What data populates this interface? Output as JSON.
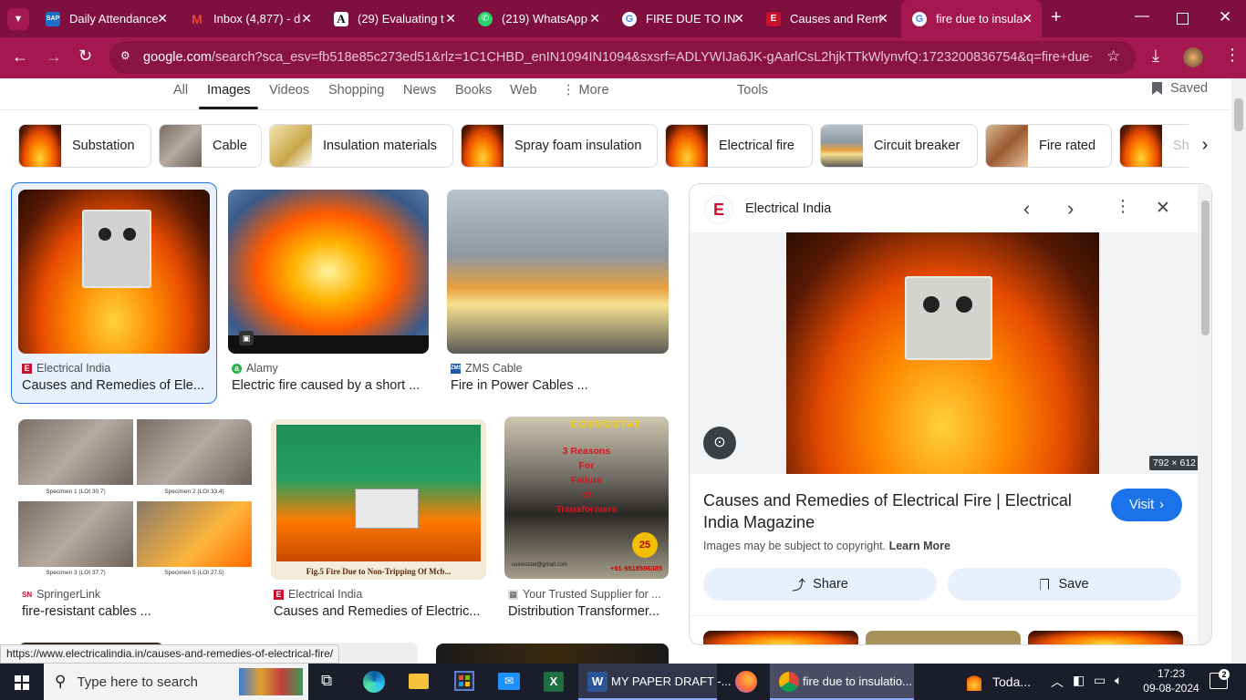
{
  "tabs": [
    {
      "label": "Daily Attendance",
      "icon": "sap-icon"
    },
    {
      "label": "Inbox (4,877) - d",
      "icon": "gmail-icon"
    },
    {
      "label": "(29) Evaluating t",
      "icon": "academia-icon"
    },
    {
      "label": "(219) WhatsApp",
      "icon": "whatsapp-icon"
    },
    {
      "label": "FIRE DUE TO INS",
      "icon": "google-icon"
    },
    {
      "label": "Causes and Rem",
      "icon": "electrical-india-icon"
    },
    {
      "label": "fire due to insula",
      "icon": "google-icon"
    }
  ],
  "address": {
    "host": "google.com",
    "path": "/search?sca_esv=fb518e85c273ed51&rlz=1C1CHBD_enIN1094IN1094&sxsrf=ADLYWIJa6JK-gAarlCsL2hjkTTkWlynvfQ:1723200836754&q=fire+due+to+ins..."
  },
  "nav": {
    "all": "All",
    "images": "Images",
    "videos": "Videos",
    "shopping": "Shopping",
    "news": "News",
    "books": "Books",
    "web": "Web",
    "more": "More",
    "tools": "Tools",
    "saved": "Saved"
  },
  "chips": [
    "Substation",
    "Cable",
    "Insulation materials",
    "Spray foam insulation",
    "Electrical fire",
    "Circuit breaker",
    "Fire rated",
    "Sh"
  ],
  "results": [
    {
      "source": "Electrical India",
      "title": "Causes and Remedies of Ele..."
    },
    {
      "source": "Alamy",
      "title": "Electric fire caused by a short ..."
    },
    {
      "source": "ZMS Cable",
      "title": "Fire in Power Cables ..."
    },
    {
      "source": "SpringerLink",
      "title": "fire-resistant cables ..."
    },
    {
      "source": "Electrical India",
      "title": "Causes and Remedies of Electric..."
    },
    {
      "source": "Your Trusted Supplier for ...",
      "title": "Distribution Transformer..."
    }
  ],
  "specimens": [
    "Specimen 1 (LOI 30.7)",
    "Specimen 2 (LOI 33.4)",
    "Specimen 3 (LOI 37.7)",
    "Specimen 5 (LOI 27.5)"
  ],
  "fig_caption": "Fig.5 Fire Due to Non-Tripping Of Mcb...",
  "poster": {
    "brand": "COSMOSTAT",
    "lines": [
      "3 Reasons",
      "For",
      "Failure",
      "of",
      "Transformers"
    ],
    "years": "25",
    "phone": "+91-9818596385",
    "email": "cosmostat@gmail.com"
  },
  "panel": {
    "source": "Electrical India",
    "dimensions": "792 × 612",
    "title": "Causes and Remedies of Electrical Fire | Electrical India Magazine",
    "copyright": "Images may be subject to copyright.",
    "learn_more": "Learn More",
    "visit": "Visit",
    "share": "Share",
    "save": "Save"
  },
  "status_url": "https://www.electricalindia.in/causes-and-remedies-of-electrical-fire/",
  "taskbar": {
    "search": "Type here to search",
    "word": "MY PAPER DRAFT -...",
    "chrome": "fire due to insulatio...",
    "weather": "Toda...",
    "time": "17:23",
    "date": "09-08-2024",
    "notifications": "2"
  },
  "colors": {
    "titlebar": "#7f0f3f",
    "toolbar": "#a5174f",
    "accent": "#1a73e8"
  }
}
